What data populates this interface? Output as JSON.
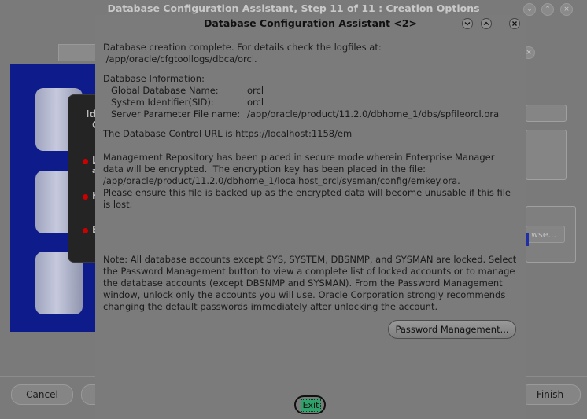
{
  "background_window": {
    "title": "Database Configuration Assistant, Step 11 of 11 : Creation Options",
    "cancel_label": "Cancel",
    "finish_label": "Finish",
    "browse_label": "wse...",
    "dark_panel_texts": [
      "Id",
      "G",
      "L",
      "a",
      "H",
      "B"
    ]
  },
  "dialog": {
    "title": "Database Configuration Assistant <2>",
    "lines": [
      "Database creation complete. For details check the logfiles at:",
      " /app/oracle/cfgtoollogs/dbca/orcl.",
      "Database Information:",
      "The Database Control URL is https://localhost:1158/em",
      "Management Repository has been placed in secure mode wherein Enterprise Manager",
      "data will be encrypted.  The encryption key has been placed in the file:",
      "/app/oracle/product/11.2.0/dbhome_1/localhost_orcl/sysman/config/emkey.ora.",
      "Please ensure this file is backed up as the encrypted data will become unusable if this file",
      "is lost.",
      "Note: All database accounts except SYS, SYSTEM, DBSNMP, and SYSMAN are locked. Select",
      "the Password Management button to view a complete list of locked accounts or to manage",
      "the database accounts (except DBSNMP and SYSMAN). From the Password Management",
      "window, unlock only the accounts you will use. Oracle Corporation strongly recommends",
      "changing the default passwords immediately after unlocking the account."
    ],
    "info": [
      {
        "label": "Global Database Name:",
        "value": "orcl"
      },
      {
        "label": "System Identifier(SID):",
        "value": "orcl"
      },
      {
        "label": "Server Parameter File name:",
        "value": "/app/oracle/product/11.2.0/dbhome_1/dbs/spfileorcl.ora"
      }
    ],
    "password_button_label": "Password Management...",
    "exit_button_label": "Exit"
  }
}
